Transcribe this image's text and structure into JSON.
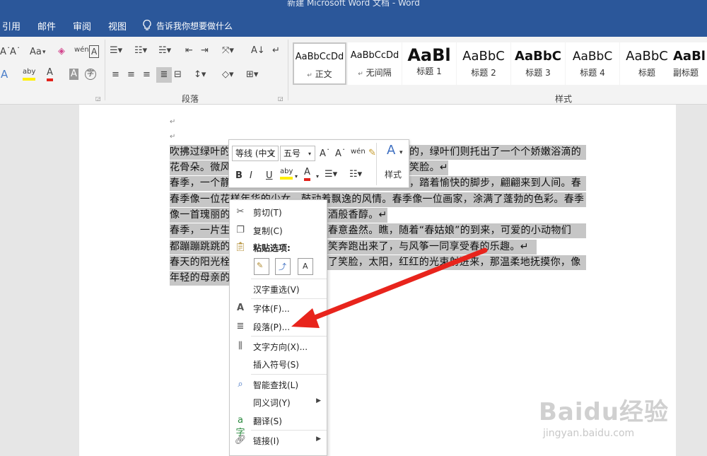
{
  "window": {
    "title": "新建 Microsoft Word 文档 - Word"
  },
  "menu": {
    "items": [
      "引用",
      "邮件",
      "审阅",
      "视图"
    ],
    "tell_me": "告诉我你想要做什么"
  },
  "ribbon": {
    "font_group": {
      "case_button": "Aa"
    },
    "paragraph_group_label": "段落",
    "styles_group_label": "样式",
    "styles": [
      {
        "sample": "AaBbCcDd",
        "name": "正文",
        "prefix": "↵"
      },
      {
        "sample": "AaBbCcDd",
        "name": "无间隔",
        "prefix": "↵"
      },
      {
        "sample": "AaBl",
        "name": "标题 1"
      },
      {
        "sample": "AaBbC",
        "name": "标题 2"
      },
      {
        "sample": "AaBbC",
        "name": "标题 3"
      },
      {
        "sample": "AaBbC",
        "name": "标题 4"
      },
      {
        "sample": "AaBbC",
        "name": "标题"
      },
      {
        "sample": "AaBl",
        "name": "副标题"
      }
    ]
  },
  "document": {
    "paragraph_mark": "↵",
    "lines": [
      {
        "left": "吹拂过绿叶的",
        "right": "的，绿叶们则托出了一个个娇嫩浴滴的"
      },
      {
        "left": "花骨朵。微风",
        "right": "笑脸。↵"
      },
      {
        "left": "春季，一个静",
        "right": "，踏着愉快的脚步，翩翩来到人间。春"
      },
      {
        "left": "春季像一位花样年华的少女，鼓动着飘逸的风情。春季像一位画家，涂满了蓬勃的色彩。春季",
        "right": ""
      },
      {
        "left": "像一首瑰丽的",
        "right": "酒般香醇。↵"
      },
      {
        "left": "春季，一片生",
        "right": "春意盎然。瞧，随着“春姑娘”的到来，可爱的小动物们"
      },
      {
        "left": "都蹦蹦跳跳的",
        "right": "笑奔跑出来了，与风筝一同享受春的乐趣。↵"
      },
      {
        "left": "春天的阳光栓",
        "right": "了笑脸，太阳，红红的光束射进来，那温柔地抚摸你，像"
      },
      {
        "left": "年轻的母亲的",
        "right": ""
      }
    ]
  },
  "mini_toolbar": {
    "font_name": "等线 (中文",
    "font_size": "五号",
    "bold": "B",
    "italic": "I",
    "underline": "U",
    "styles_label": "样式"
  },
  "context_menu": {
    "items": [
      {
        "label": "剪切(T)",
        "icon": "scissors-icon"
      },
      {
        "label": "复制(C)",
        "icon": "copy-icon"
      },
      {
        "label": "粘贴选项:",
        "icon": "paste-icon"
      },
      {
        "label": "汉字重选(V)"
      },
      {
        "label": "字体(F)...",
        "icon": "font-icon"
      },
      {
        "label": "段落(P)...",
        "icon": "paragraph-icon"
      },
      {
        "label": "文字方向(X)...",
        "icon": "text-direction-icon"
      },
      {
        "label": "插入符号(S)"
      },
      {
        "label": "智能查找(L)",
        "icon": "smart-lookup-icon"
      },
      {
        "label": "同义词(Y)",
        "submenu": true
      },
      {
        "label": "翻译(S)",
        "icon": "translate-icon"
      },
      {
        "label": "链接(I)",
        "icon": "link-icon",
        "submenu": true
      }
    ]
  },
  "watermark": {
    "brand": "Baidu经验",
    "url": "jingyan.baidu.com"
  },
  "colors": {
    "accent": "#2b579a",
    "selection": "#c6c6c6",
    "arrow": "#e8241c"
  }
}
